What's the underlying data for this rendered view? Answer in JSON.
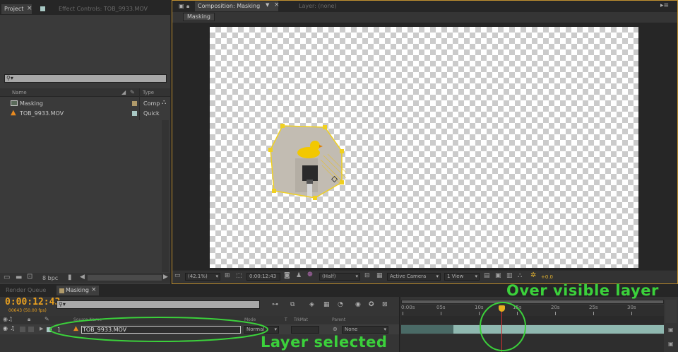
{
  "project_panel": {
    "tabs": [
      {
        "label": "Project",
        "close": "×"
      },
      {
        "label": "Effect Controls: TOB_9933.MOV"
      }
    ],
    "search_glyph": "⚲▾",
    "columns": {
      "name": "Name",
      "type": "Type"
    },
    "items": [
      {
        "name": "Masking",
        "type": "Comp",
        "icon": "composition-icon",
        "swatch": "#b09a6a"
      },
      {
        "name": "TOB_9933.MOV",
        "type": "Quick",
        "icon": "footage-cone-icon",
        "swatch": "#a8c8c4"
      }
    ],
    "footer": {
      "bpc": "8 bpc"
    }
  },
  "composition_panel": {
    "tabs": [
      {
        "label": "Composition: Masking",
        "close": "×"
      },
      {
        "label": "Layer: (none)"
      }
    ],
    "breadcrumb": "Masking",
    "footer": {
      "zoom": "(42.1%)",
      "timecode": "0:00:12:43",
      "resolution": "(Half)",
      "camera": "Active Camera",
      "views": "1 View",
      "exposure": "+0.0"
    }
  },
  "timeline_panel": {
    "tabs": [
      {
        "label": "Render Queue"
      },
      {
        "label": "Masking",
        "close": "×"
      }
    ],
    "current_time": "0:00:12:43",
    "frame_info": "00643 (50.00 fps)",
    "search_glyph": "⚲▾",
    "columns": {
      "source_name": "Source Name",
      "mode": "Mode",
      "t": "T",
      "trkmat": "TrkMat",
      "parent": "Parent"
    },
    "ruler": [
      "0:00s",
      "05s",
      "10s",
      "15s",
      "20s",
      "25s",
      "30s"
    ],
    "layers": [
      {
        "number": "1",
        "name": "TOB_9933.MOV",
        "mode": "Normal",
        "parent": "None"
      }
    ],
    "colors": {
      "time_display": "#e8a020",
      "layer_bar": "#8fb8b0",
      "playhead": "#d03030"
    }
  },
  "annotations": {
    "over_visible_layer": "Over visible layer",
    "layer_selected": "Layer selected",
    "color": "#3bd13b"
  }
}
